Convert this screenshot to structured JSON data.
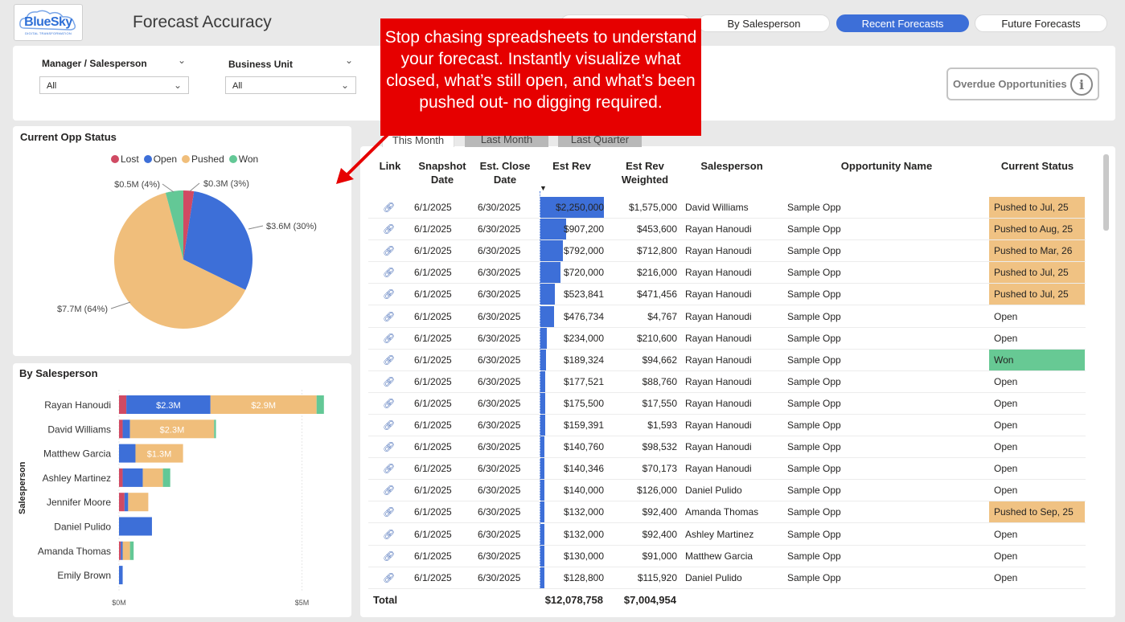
{
  "header": {
    "logo_text": "BlueSky",
    "logo_subtext": "DIGITAL TRANSFORMATION",
    "title": "Forecast Accuracy",
    "nav": [
      "By Salesperson",
      "Recent Forecasts",
      "Future Forecasts"
    ],
    "active_nav": "Recent Forecasts"
  },
  "filters": {
    "manager_label": "Manager / Salesperson",
    "manager_value": "All",
    "bu_label": "Business Unit",
    "bu_value": "All"
  },
  "overdue": {
    "label": "Overdue Opportunities",
    "icon": "info-icon"
  },
  "callout": {
    "text": "Stop chasing spreadsheets to understand your forecast. Instantly visualize what closed, what’s still open, and what’s been pushed out- no digging required."
  },
  "opp_status": {
    "title": "Current Opp Status",
    "legend": [
      "Lost",
      "Open",
      "Pushed",
      "Won"
    ],
    "colors": {
      "Lost": "#d04a63",
      "Open": "#3d6fd8",
      "Pushed": "#f0be7b",
      "Won": "#63c896"
    },
    "labels": {
      "lost": "$0.3M (3%)",
      "open": "$3.6M (30%)",
      "pushed": "$7.7M (64%)",
      "won": "$0.5M (4%)"
    }
  },
  "by_salesperson": {
    "title": "By Salesperson",
    "axis_title": "Salesperson",
    "axis_ticks": [
      "$0M",
      "$5M"
    ]
  },
  "tabs": [
    "This Month",
    "Last Month",
    "Last Quarter"
  ],
  "table": {
    "headers": {
      "link": "Link",
      "snapshot": "Snapshot Date",
      "close": "Est. Close Date",
      "rev": "Est Rev",
      "weighted": "Est Rev Weighted",
      "salesperson": "Salesperson",
      "opp": "Opportunity Name",
      "status": "Current Status"
    },
    "rows": [
      {
        "snap": "6/1/2025",
        "close": "6/30/2025",
        "rev": "$2,250,000",
        "w": "$1,575,000",
        "sp": "David Williams",
        "opp": "Sample Opp",
        "status": "Pushed to Jul, 25",
        "kind": "pushed"
      },
      {
        "snap": "6/1/2025",
        "close": "6/30/2025",
        "rev": "$907,200",
        "w": "$453,600",
        "sp": "Rayan Hanoudi",
        "opp": "Sample Opp",
        "status": "Pushed to Aug, 25",
        "kind": "pushed"
      },
      {
        "snap": "6/1/2025",
        "close": "6/30/2025",
        "rev": "$792,000",
        "w": "$712,800",
        "sp": "Rayan Hanoudi",
        "opp": "Sample Opp",
        "status": "Pushed to Mar, 26",
        "kind": "pushed"
      },
      {
        "snap": "6/1/2025",
        "close": "6/30/2025",
        "rev": "$720,000",
        "w": "$216,000",
        "sp": "Rayan Hanoudi",
        "opp": "Sample Opp",
        "status": "Pushed to Jul, 25",
        "kind": "pushed"
      },
      {
        "snap": "6/1/2025",
        "close": "6/30/2025",
        "rev": "$523,841",
        "w": "$471,456",
        "sp": "Rayan Hanoudi",
        "opp": "Sample Opp",
        "status": "Pushed to Jul, 25",
        "kind": "pushed"
      },
      {
        "snap": "6/1/2025",
        "close": "6/30/2025",
        "rev": "$476,734",
        "w": "$4,767",
        "sp": "Rayan Hanoudi",
        "opp": "Sample Opp",
        "status": "Open",
        "kind": "open"
      },
      {
        "snap": "6/1/2025",
        "close": "6/30/2025",
        "rev": "$234,000",
        "w": "$210,600",
        "sp": "Rayan Hanoudi",
        "opp": "Sample Opp",
        "status": "Open",
        "kind": "open"
      },
      {
        "snap": "6/1/2025",
        "close": "6/30/2025",
        "rev": "$189,324",
        "w": "$94,662",
        "sp": "Rayan Hanoudi",
        "opp": "Sample Opp",
        "status": "Won",
        "kind": "won"
      },
      {
        "snap": "6/1/2025",
        "close": "6/30/2025",
        "rev": "$177,521",
        "w": "$88,760",
        "sp": "Rayan Hanoudi",
        "opp": "Sample Opp",
        "status": "Open",
        "kind": "open"
      },
      {
        "snap": "6/1/2025",
        "close": "6/30/2025",
        "rev": "$175,500",
        "w": "$17,550",
        "sp": "Rayan Hanoudi",
        "opp": "Sample Opp",
        "status": "Open",
        "kind": "open"
      },
      {
        "snap": "6/1/2025",
        "close": "6/30/2025",
        "rev": "$159,391",
        "w": "$1,593",
        "sp": "Rayan Hanoudi",
        "opp": "Sample Opp",
        "status": "Open",
        "kind": "open"
      },
      {
        "snap": "6/1/2025",
        "close": "6/30/2025",
        "rev": "$140,760",
        "w": "$98,532",
        "sp": "Rayan Hanoudi",
        "opp": "Sample Opp",
        "status": "Open",
        "kind": "open"
      },
      {
        "snap": "6/1/2025",
        "close": "6/30/2025",
        "rev": "$140,346",
        "w": "$70,173",
        "sp": "Rayan Hanoudi",
        "opp": "Sample Opp",
        "status": "Open",
        "kind": "open"
      },
      {
        "snap": "6/1/2025",
        "close": "6/30/2025",
        "rev": "$140,000",
        "w": "$126,000",
        "sp": "Daniel Pulido",
        "opp": "Sample Opp",
        "status": "Open",
        "kind": "open"
      },
      {
        "snap": "6/1/2025",
        "close": "6/30/2025",
        "rev": "$132,000",
        "w": "$92,400",
        "sp": "Amanda Thomas",
        "opp": "Sample Opp",
        "status": "Pushed to Sep, 25",
        "kind": "pushed"
      },
      {
        "snap": "6/1/2025",
        "close": "6/30/2025",
        "rev": "$132,000",
        "w": "$92,400",
        "sp": "Ashley Martinez",
        "opp": "Sample Opp",
        "status": "Open",
        "kind": "open"
      },
      {
        "snap": "6/1/2025",
        "close": "6/30/2025",
        "rev": "$130,000",
        "w": "$91,000",
        "sp": "Matthew Garcia",
        "opp": "Sample Opp",
        "status": "Open",
        "kind": "open"
      },
      {
        "snap": "6/1/2025",
        "close": "6/30/2025",
        "rev": "$128,800",
        "w": "$115,920",
        "sp": "Daniel Pulido",
        "opp": "Sample Opp",
        "status": "Open",
        "kind": "open"
      }
    ],
    "total_label": "Total",
    "total_rev": "$12,078,758",
    "total_weighted": "$7,004,954"
  },
  "chart_data": [
    {
      "type": "pie",
      "title": "Current Opp Status",
      "categories": [
        "Lost",
        "Open",
        "Pushed",
        "Won"
      ],
      "values": [
        0.3,
        3.6,
        7.7,
        0.5
      ],
      "percent": [
        3,
        30,
        64,
        4
      ],
      "data_labels": [
        "$0.3M (3%)",
        "$3.6M (30%)",
        "$7.7M (64%)",
        "$0.5M (4%)"
      ]
    },
    {
      "type": "bar",
      "title": "By Salesperson",
      "ylabel": "Salesperson",
      "categories": [
        "Rayan Hanoudi",
        "David Williams",
        "Matthew Garcia",
        "Ashley Martinez",
        "Jennifer Moore",
        "Daniel Pulido",
        "Amanda Thomas",
        "Emily Brown"
      ],
      "series": [
        {
          "name": "Lost",
          "values": [
            0.2,
            0.1,
            0.0,
            0.1,
            0.15,
            0.0,
            0.05,
            0.0
          ]
        },
        {
          "name": "Open",
          "values": [
            2.3,
            0.2,
            0.45,
            0.55,
            0.1,
            0.9,
            0.05,
            0.1
          ]
        },
        {
          "name": "Pushed",
          "values": [
            2.9,
            2.3,
            1.3,
            0.55,
            0.55,
            0.0,
            0.2,
            0.0
          ]
        },
        {
          "name": "Won",
          "values": [
            0.2,
            0.05,
            0.0,
            0.2,
            0.0,
            0.0,
            0.1,
            0.0
          ]
        }
      ],
      "data_labels": {
        "Open": [
          "$2.3M",
          "",
          "",
          "",
          "",
          "",
          "",
          ""
        ],
        "Pushed": [
          "$2.9M",
          "$2.3M",
          "$1.3M",
          "",
          "",
          "",
          "",
          ""
        ]
      },
      "xlim": [
        0,
        5.5
      ],
      "xticks": [
        "$0M",
        "$5M"
      ]
    }
  ]
}
